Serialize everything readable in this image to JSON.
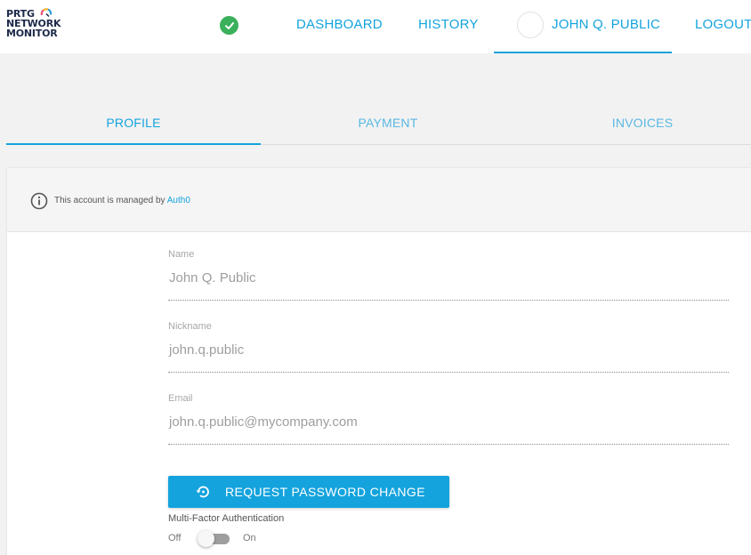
{
  "app": {
    "logo_lines": [
      "PRTG",
      "NETWORK",
      "MONITOR"
    ]
  },
  "header": {
    "status_icon": "check-circle",
    "nav": {
      "dashboard": "DASHBOARD",
      "history": "HISTORY",
      "user": "JOHN Q. PUBLIC",
      "logout": "LOGOUT"
    }
  },
  "tabs": [
    {
      "label": "PROFILE",
      "active": true
    },
    {
      "label": "PAYMENT",
      "active": false
    },
    {
      "label": "INVOICES",
      "active": false
    }
  ],
  "notice": {
    "icon": "info-icon",
    "text": "This account is managed by ",
    "link": "Auth0"
  },
  "form": {
    "name": {
      "label": "Name",
      "value": "John Q. Public"
    },
    "nickname": {
      "label": "Nickname",
      "value": "john.q.public"
    },
    "email": {
      "label": "Email",
      "value": "john.q.public@mycompany.com"
    },
    "password_button": "REQUEST PASSWORD CHANGE",
    "mfa": {
      "label": "Multi-Factor Authentication",
      "off_label": "Off",
      "on_label": "On",
      "enabled": false
    }
  },
  "colors": {
    "accent": "#14a3dd",
    "status_ok": "#3bb05c",
    "brand_text": "#1d2a4a"
  }
}
